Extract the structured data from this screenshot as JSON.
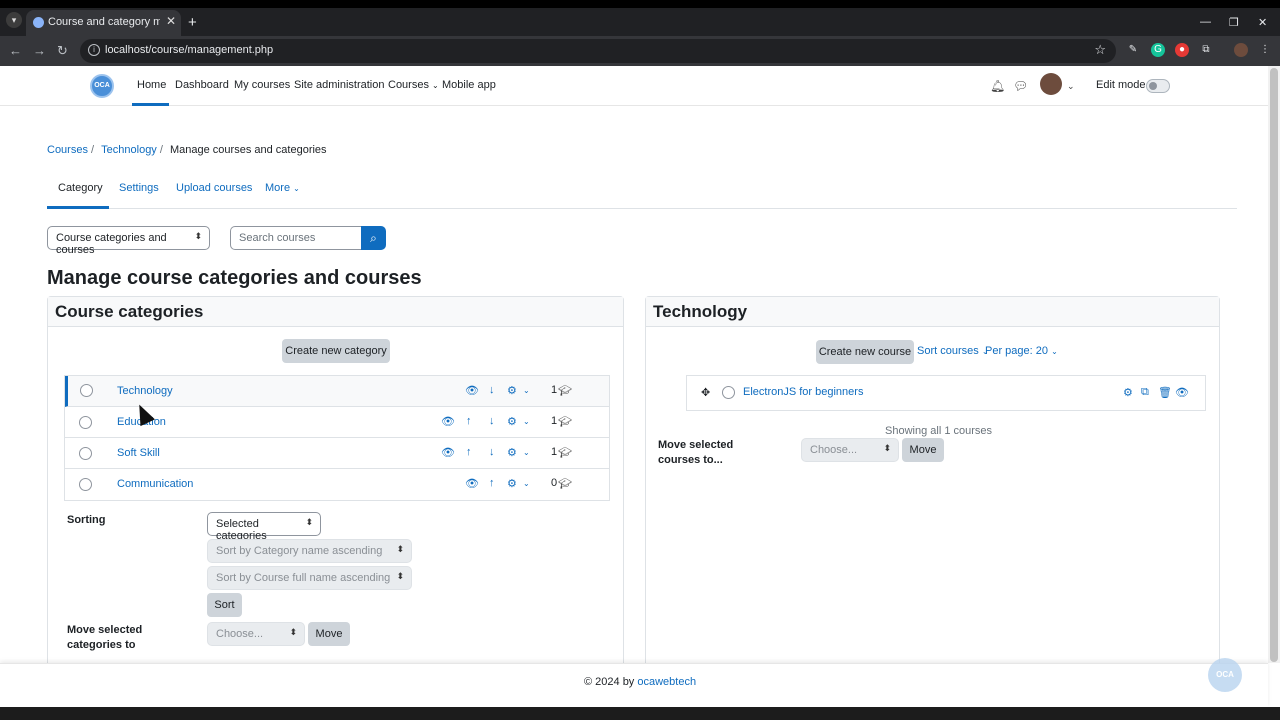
{
  "browser": {
    "tab_title": "Course and category managem",
    "url": "localhost/course/management.php"
  },
  "nav": {
    "logo": "OCA",
    "links": [
      "Home",
      "Dashboard",
      "My courses",
      "Site administration",
      "Courses",
      "Mobile app"
    ],
    "edit_mode": "Edit mode"
  },
  "breadcrumb": [
    "Courses",
    "Technology",
    "Manage courses and categories"
  ],
  "subnav": [
    "Category",
    "Settings",
    "Upload courses",
    "More"
  ],
  "view_select": "Course categories and courses",
  "search_placeholder": "Search courses",
  "page_title": "Manage course categories and courses",
  "categories_panel": {
    "title": "Course categories",
    "create_button": "Create new category",
    "rows": [
      {
        "name": "Technology",
        "count": "1"
      },
      {
        "name": "Education",
        "count": "1"
      },
      {
        "name": "Soft Skill",
        "count": "1"
      },
      {
        "name": "Communication",
        "count": "0"
      }
    ],
    "sorting_label": "Sorting",
    "sort_scope": "Selected categories",
    "sort_category": "Sort by Category name ascending",
    "sort_course": "Sort by Course full name ascending",
    "sort_button": "Sort",
    "move_label": "Move selected categories to",
    "move_select": "Choose...",
    "move_button": "Move"
  },
  "courses_panel": {
    "title": "Technology",
    "create_button": "Create new course",
    "sort_courses": "Sort courses",
    "per_page": "Per page: 20",
    "course": "ElectronJS for beginners",
    "showing": "Showing all 1 courses",
    "move_label": "Move selected courses to...",
    "move_select": "Choose...",
    "move_button": "Move"
  },
  "footer": {
    "copyright": "© 2024 by",
    "link": "ocawebtech"
  },
  "colors": {
    "accent": "#0f6cbf",
    "text": "#1d2125"
  }
}
